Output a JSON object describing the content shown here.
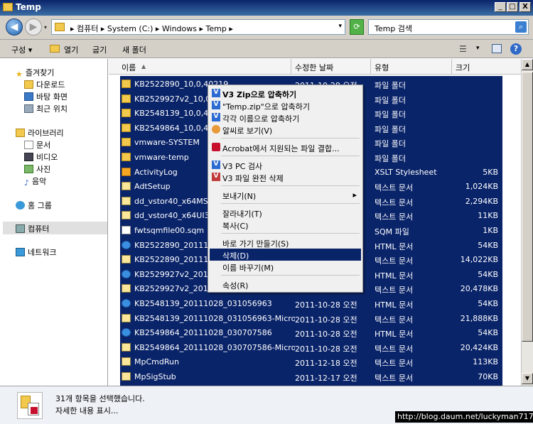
{
  "window": {
    "title": "Temp",
    "caption_buttons": [
      "_",
      "□",
      "X"
    ]
  },
  "address": {
    "crumbs": "▸ 컴퓨터 ▸ System (C:) ▸ Windows ▸ Temp ▸",
    "search_placeholder": "Temp 검색"
  },
  "toolbar": {
    "organize": "구성 ▾",
    "open": "열기",
    "burn": "굽기",
    "new_folder": "새 폴더"
  },
  "nav": {
    "favorites": "즐겨찾기",
    "fav_items": [
      "다운로드",
      "바탕 화면",
      "최근 위치"
    ],
    "libraries": "라이브러리",
    "lib_items": [
      "문서",
      "비디오",
      "사진",
      "음악"
    ],
    "homegroup": "홈 그룹",
    "computer": "컴퓨터",
    "network": "네트워크"
  },
  "columns": {
    "name": "이름",
    "date": "수정한 날짜",
    "type": "유형",
    "size": "크기"
  },
  "files": [
    {
      "name": "KB2522890_10,0,40219",
      "date": "2011-10-28 오전",
      "type": "파일 폴더",
      "size": "",
      "icon": "folder"
    },
    {
      "name": "KB2529927v2_10,0,40219",
      "date": "",
      "type": "파일 폴더",
      "size": "",
      "icon": "folder"
    },
    {
      "name": "KB2548139_10,0,40219",
      "date": "",
      "type": "파일 폴더",
      "size": "",
      "icon": "folder"
    },
    {
      "name": "KB2549864_10,0,40219",
      "date": "",
      "type": "파일 폴더",
      "size": "",
      "icon": "folder"
    },
    {
      "name": "vmware-SYSTEM",
      "date": "",
      "type": "파일 폴더",
      "size": "",
      "icon": "folder"
    },
    {
      "name": "vmware-temp",
      "date": "",
      "type": "파일 폴더",
      "size": "",
      "icon": "folder"
    },
    {
      "name": "ActivityLog",
      "date": "",
      "type": "XSLT Stylesheet",
      "size": "5KB",
      "icon": "xml"
    },
    {
      "name": "AdtSetup",
      "date": "",
      "type": "텍스트 문서",
      "size": "1,024KB",
      "icon": "log"
    },
    {
      "name": "dd_vstor40_x64MSI3",
      "date": "",
      "type": "텍스트 문서",
      "size": "2,294KB",
      "icon": "log"
    },
    {
      "name": "dd_vstor40_x64UI3F",
      "date": "",
      "type": "텍스트 문서",
      "size": "11KB",
      "icon": "log"
    },
    {
      "name": "fwtsqmfile00.sqm",
      "date": "",
      "type": "SQM 파일",
      "size": "1KB",
      "icon": "doc"
    },
    {
      "name": "KB2522890_201110",
      "date": "",
      "type": "HTML 문서",
      "size": "54KB",
      "icon": "ie"
    },
    {
      "name": "KB2522890_201110",
      "date": "",
      "type": "텍스트 문서",
      "size": "14,022KB",
      "icon": "log"
    },
    {
      "name": "KB2529927v2_2011",
      "date": "",
      "type": "HTML 문서",
      "size": "54KB",
      "icon": "ie"
    },
    {
      "name": "KB2529927v2_2011",
      "date": "",
      "type": "텍스트 문서",
      "size": "20,478KB",
      "icon": "log"
    },
    {
      "name": "KB2548139_20111028_031056963",
      "date": "2011-10-28 오전",
      "type": "HTML 문서",
      "size": "54KB",
      "icon": "ie"
    },
    {
      "name": "KB2548139_20111028_031056963-Micro,...",
      "date": "2011-10-28 오전",
      "type": "텍스트 문서",
      "size": "21,888KB",
      "icon": "log"
    },
    {
      "name": "KB2549864_20111028_030707586",
      "date": "2011-10-28 오전",
      "type": "HTML 문서",
      "size": "54KB",
      "icon": "ie"
    },
    {
      "name": "KB2549864_20111028_030707586-Micro,...",
      "date": "2011-10-28 오전",
      "type": "텍스트 문서",
      "size": "20,424KB",
      "icon": "log"
    },
    {
      "name": "MpCmdRun",
      "date": "2011-12-18 오전",
      "type": "텍스트 문서",
      "size": "113KB",
      "icon": "log"
    },
    {
      "name": "MpSigStub",
      "date": "2011-12-17 오전",
      "type": "텍스트 문서",
      "size": "70KB",
      "icon": "log"
    }
  ],
  "context_menu": {
    "items": [
      {
        "label": "V3 Zip으로 압축하기",
        "bold": true,
        "icon": "v3"
      },
      {
        "label": "\"Temp.zip\"으로 압축하기",
        "bold": false,
        "icon": "v3"
      },
      {
        "label": "각각 이름으로 압축하기",
        "bold": false,
        "icon": "v3"
      },
      {
        "label": "알씨로 보기(V)",
        "bold": false,
        "icon": "alsee"
      },
      {
        "label": "Acrobat에서 지원되는 파일 결합...",
        "bold": false,
        "icon": "acrobat"
      },
      {
        "label": "V3 PC 검사",
        "bold": false,
        "icon": "v3"
      },
      {
        "label": "V3 파일 완전 삭제",
        "bold": false,
        "icon": "v3"
      },
      {
        "label": "보내기(N)",
        "bold": false,
        "icon": "",
        "submenu": "▸"
      },
      {
        "label": "잘라내기(T)",
        "bold": false,
        "icon": ""
      },
      {
        "label": "복사(C)",
        "bold": false,
        "icon": ""
      },
      {
        "label": "바로 가기 만들기(S)",
        "bold": false,
        "icon": ""
      },
      {
        "label": "삭제(D)",
        "bold": false,
        "icon": "",
        "highlighted": true
      },
      {
        "label": "이름 바꾸기(M)",
        "bold": false,
        "icon": ""
      },
      {
        "label": "속성(R)",
        "bold": false,
        "icon": ""
      }
    ]
  },
  "details": {
    "line1": "31개 항목을 선택했습니다.",
    "line2": "자세한 내용 표시..."
  },
  "watermark": "http://blog.daum.net/luckyman717",
  "colors": {
    "selection": "#0a246a",
    "chrome": "#d4d0c8"
  }
}
